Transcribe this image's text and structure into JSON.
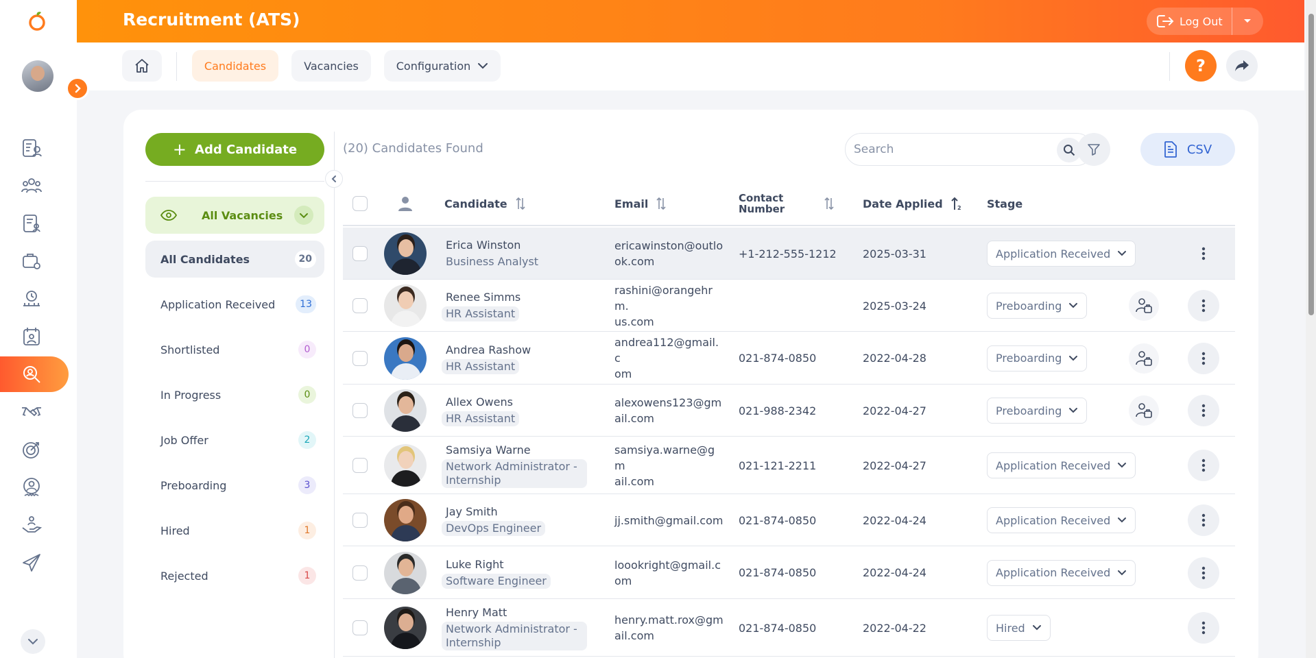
{
  "app": {
    "title": "Recruitment (ATS)",
    "logout_label": "Log Out"
  },
  "nav": {
    "home_icon": "home-icon",
    "candidates": "Candidates",
    "vacancies": "Vacancies",
    "configuration": "Configuration",
    "help": "?"
  },
  "rail_icons": [
    "employee-list-icon",
    "people-icon",
    "document-user-icon",
    "briefcase-gear-icon",
    "clock-dashboard-icon",
    "calendar-user-icon",
    "recruitment-search-icon",
    "handshake-icon",
    "target-icon",
    "award-user-icon",
    "hand-care-icon",
    "plane-icon"
  ],
  "left": {
    "add_label": "Add Candidate",
    "vacancy_filter": "All Vacancies",
    "stages": [
      {
        "name": "All Candidates",
        "count": "20",
        "color": "#64728c",
        "bg": "#ffffff"
      },
      {
        "name": "Application Received",
        "count": "13",
        "color": "#2f6fd6",
        "bg": "#e3eefc"
      },
      {
        "name": "Shortlisted",
        "count": "0",
        "color": "#b25ccf",
        "bg": "#f7ebfb"
      },
      {
        "name": "In Progress",
        "count": "0",
        "color": "#5b8d12",
        "bg": "#eaf5dc"
      },
      {
        "name": "Job Offer",
        "count": "2",
        "color": "#1aa6b8",
        "bg": "#e2f6f8"
      },
      {
        "name": "Preboarding",
        "count": "3",
        "color": "#5a4fcf",
        "bg": "#ecebfb"
      },
      {
        "name": "Hired",
        "count": "1",
        "color": "#e0782a",
        "bg": "#fdeee2"
      },
      {
        "name": "Rejected",
        "count": "1",
        "color": "#d84a4a",
        "bg": "#fbe6e6"
      }
    ]
  },
  "table": {
    "found_text": "(20) Candidates Found",
    "search_placeholder": "Search",
    "csv_label": "CSV",
    "headers": {
      "candidate": "Candidate",
      "email": "Email",
      "contact_1": "Contact",
      "contact_2": "Number",
      "date": "Date Applied",
      "stage": "Stage"
    },
    "rows": [
      {
        "name": "Erica Winston",
        "role": "Business Analyst",
        "email": "ericawinston@outlook.com",
        "email_1": "ericawinston@outlo",
        "email_2": "ok.com",
        "contact": "+1-212-555-1212",
        "date": "2025-03-31",
        "stage": "Application Received",
        "onboard": false,
        "skin": "#e7bfa3",
        "hair": "#2a1f1a",
        "shirt": "#1e2430",
        "bg": "#2f4a6a"
      },
      {
        "name": "Renee Simms",
        "role": "HR Assistant",
        "email_1": "rashini@orangehrm.",
        "email_2": "us.com",
        "contact": "",
        "date": "2025-03-24",
        "stage": "Preboarding",
        "onboard": true,
        "skin": "#f0cdb4",
        "hair": "#3b2a20",
        "shirt": "#f2f2f2",
        "bg": "#e8e8e8"
      },
      {
        "name": "Andrea Rashow",
        "role": "HR Assistant",
        "email_1": "andrea112@gmail.c",
        "email_2": "om",
        "contact": "021-874-0850",
        "date": "2022-04-28",
        "stage": "Preboarding",
        "onboard": true,
        "skin": "#d9a98c",
        "hair": "#1c1512",
        "shirt": "#e9eef5",
        "bg": "#3a78c2"
      },
      {
        "name": "Allex Owens",
        "role": "HR Assistant",
        "email_1": "alexowens123@gm",
        "email_2": "ail.com",
        "contact": "021-988-2342",
        "date": "2022-04-27",
        "stage": "Preboarding",
        "onboard": true,
        "skin": "#e3b79a",
        "hair": "#2b2118",
        "shirt": "#2a2f3a",
        "bg": "#dfe2e6"
      },
      {
        "name": "Samsiya Warne",
        "role": "Network Administrator - Internship",
        "role_1": "Network Administrator -",
        "role_2": "Internship",
        "email_1": "samsiya.warne@gm",
        "email_2": "ail.com",
        "contact": "021-121-2211",
        "date": "2022-04-27",
        "stage": "Application Received",
        "onboard": false,
        "skin": "#f1d2bb",
        "hair": "#e2c57a",
        "shirt": "#1d1d1f",
        "bg": "#e9eaec"
      },
      {
        "name": "Jay Smith",
        "role": "DevOps Engineer",
        "email_1": "jj.smith@gmail.com",
        "email_2": "",
        "contact": "021-874-0850",
        "date": "2022-04-24",
        "stage": "Application Received",
        "onboard": false,
        "skin": "#e0a987",
        "hair": "#4a2d1a",
        "shirt": "#2d3a55",
        "bg": "#7a4b2a"
      },
      {
        "name": "Luke Right",
        "role": "Software Engineer",
        "email_1": "loookright@gmail.c",
        "email_2": "om",
        "contact": "021-874-0850",
        "date": "2022-04-24",
        "stage": "Application Received",
        "onboard": false,
        "skin": "#e2b596",
        "hair": "#2a2a2a",
        "shirt": "#5a6370",
        "bg": "#d8dadd"
      },
      {
        "name": "Henry Matt",
        "role": "Network Administrator - Internship",
        "role_1": "Network Administrator -",
        "role_2": "Internship",
        "email_1": "henry.matt.rox@gm",
        "email_2": "ail.com",
        "contact": "021-874-0850",
        "date": "2022-04-22",
        "stage": "Hired",
        "onboard": false,
        "skin": "#dcae92",
        "hair": "#1e1a17",
        "shirt": "#15171c",
        "bg": "#3a3d42"
      }
    ]
  },
  "colors": {
    "brand_orange": "#ff7b1d",
    "brand_green": "#76ac21",
    "text": "#3f4a60",
    "muted": "#64728c"
  }
}
